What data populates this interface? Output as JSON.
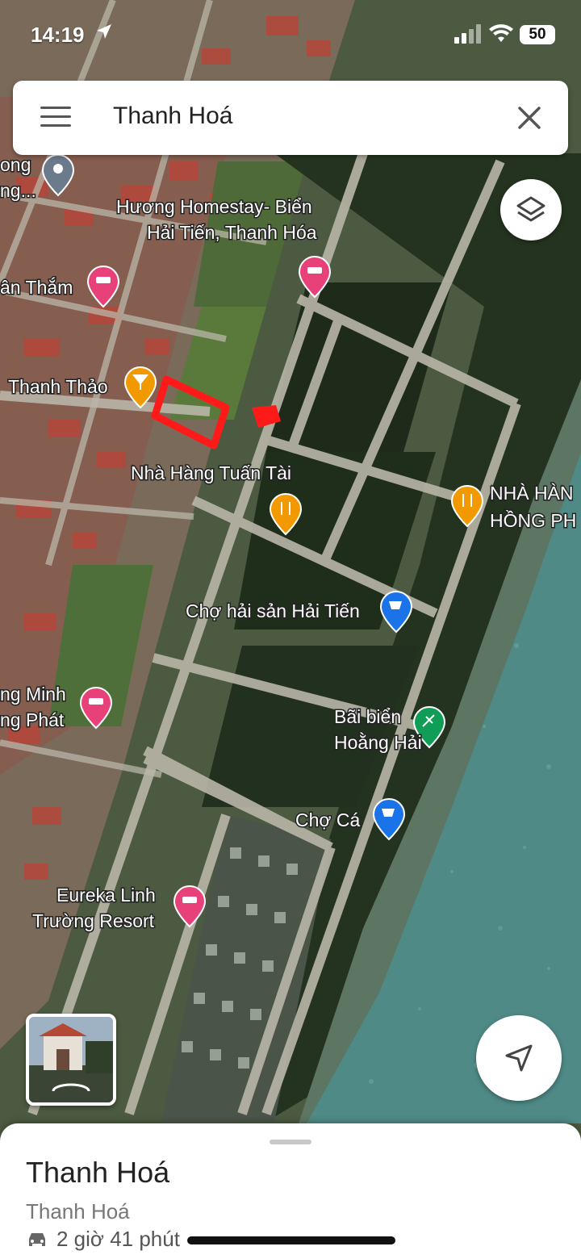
{
  "status_bar": {
    "time": "14:19",
    "battery": "50"
  },
  "search_bar": {
    "query": "Thanh Hoá"
  },
  "map_labels": {
    "huong_homestay_line1": "Hương Homestay- Biển",
    "huong_homestay_line2": "Hải Tiến, Thanh Hóa",
    "ong_line1": "ong",
    "ong_line2": "ng...",
    "an_tham": "ân Thắm",
    "thanh_thao": "Thanh Thảo",
    "nha_hang_tuan_tai": "Nhà Hàng Tuấn Tài",
    "nha_hang_hong_line1": "NHÀ HÀN",
    "nha_hang_hong_line2": "HỒNG PH",
    "cho_hai_san": "Chợ hải sản Hải Tiến",
    "ng_minh_line1": "ng Minh",
    "ng_minh_line2": "ng Phát",
    "bai_bien_line1": "Bãi biển",
    "bai_bien_line2": "Hoằng Hải",
    "cho_ca": "Chợ Cá",
    "eureka_line1": "Eureka Linh",
    "eureka_line2": "Trường Resort"
  },
  "bottom_sheet": {
    "title": "Thanh Hoá",
    "subtitle": "Thanh Hoá",
    "drive_time": "2 giờ 41 phút"
  },
  "colors": {
    "hotel_pin": "#e8417a",
    "food_pin": "#f29900",
    "shop_pin": "#1a73e8",
    "beach_pin": "#0f9d58",
    "generic_pin": "#6b7b8c",
    "highlight": "#ff1a1a",
    "sea": "#4f8a86",
    "forest": "#24331f"
  },
  "icons": {
    "menu": "menu-icon",
    "close": "close-icon",
    "layers": "layers-icon",
    "locate": "navigation-arrow-icon",
    "car": "car-icon"
  }
}
